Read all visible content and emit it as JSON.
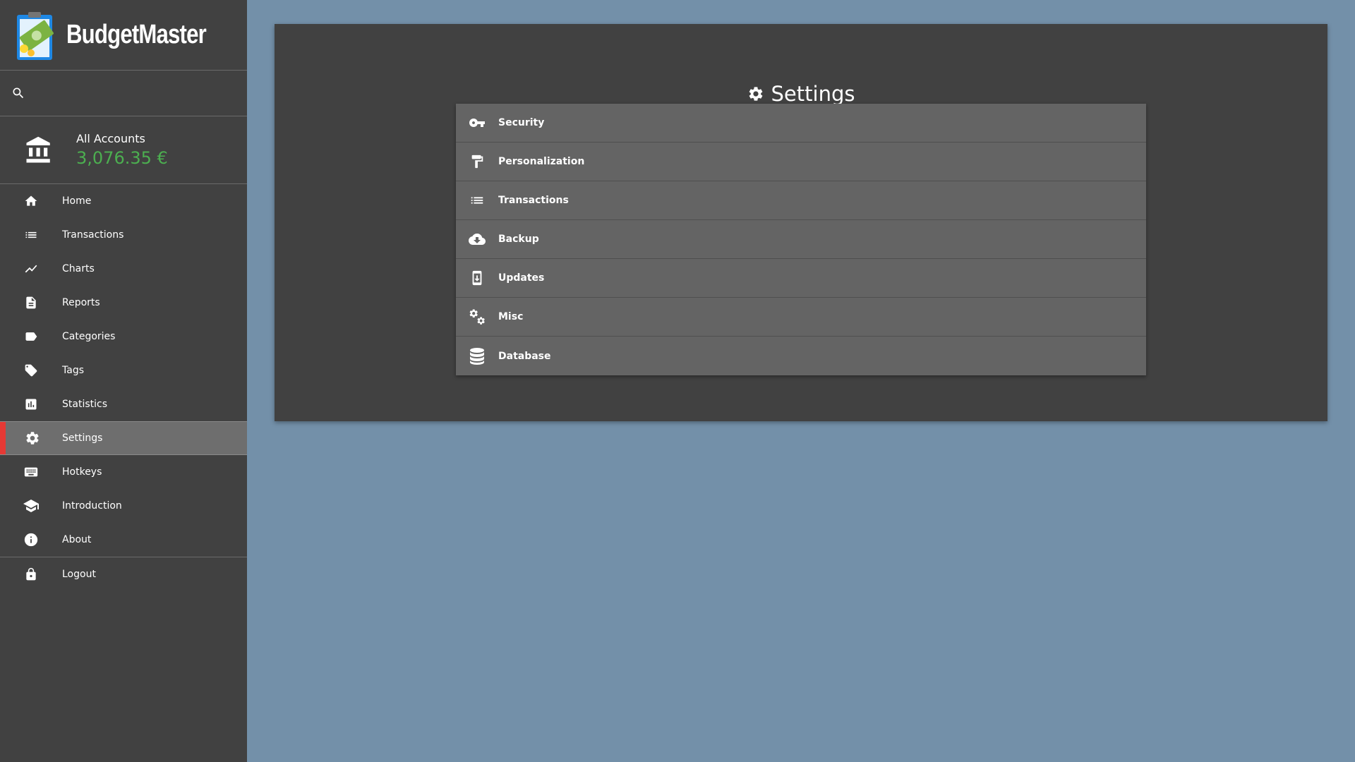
{
  "app": {
    "name": "BudgetMaster"
  },
  "search": {
    "icon": "search-icon"
  },
  "account": {
    "name": "All Accounts",
    "balance": "3,076.35 €",
    "icon": "bank-icon"
  },
  "sidebar": {
    "items": [
      {
        "label": "Home",
        "icon": "home-icon"
      },
      {
        "label": "Transactions",
        "icon": "list-icon"
      },
      {
        "label": "Charts",
        "icon": "trending-icon"
      },
      {
        "label": "Reports",
        "icon": "document-icon"
      },
      {
        "label": "Categories",
        "icon": "label-icon"
      },
      {
        "label": "Tags",
        "icon": "tag-icon"
      },
      {
        "label": "Statistics",
        "icon": "bar-chart-icon"
      },
      {
        "label": "Settings",
        "icon": "gear-icon",
        "active": true
      },
      {
        "label": "Hotkeys",
        "icon": "keyboard-icon"
      },
      {
        "label": "Introduction",
        "icon": "school-icon"
      },
      {
        "label": "About",
        "icon": "info-icon"
      },
      {
        "label": "Logout",
        "icon": "lock-icon"
      }
    ]
  },
  "main": {
    "title": "Settings",
    "title_icon": "gear-icon",
    "settings": [
      {
        "label": "Security",
        "icon": "key-icon"
      },
      {
        "label": "Personalization",
        "icon": "paint-roller-icon"
      },
      {
        "label": "Transactions",
        "icon": "list-icon"
      },
      {
        "label": "Backup",
        "icon": "cloud-download-icon"
      },
      {
        "label": "Updates",
        "icon": "system-update-icon"
      },
      {
        "label": "Misc",
        "icon": "gears-icon"
      },
      {
        "label": "Database",
        "icon": "database-icon"
      }
    ]
  },
  "colors": {
    "sidebar_bg": "#414141",
    "page_bg": "#7390a9",
    "active_accent": "#e53935",
    "balance_positive": "#4caf50",
    "list_item_bg": "#646464"
  }
}
